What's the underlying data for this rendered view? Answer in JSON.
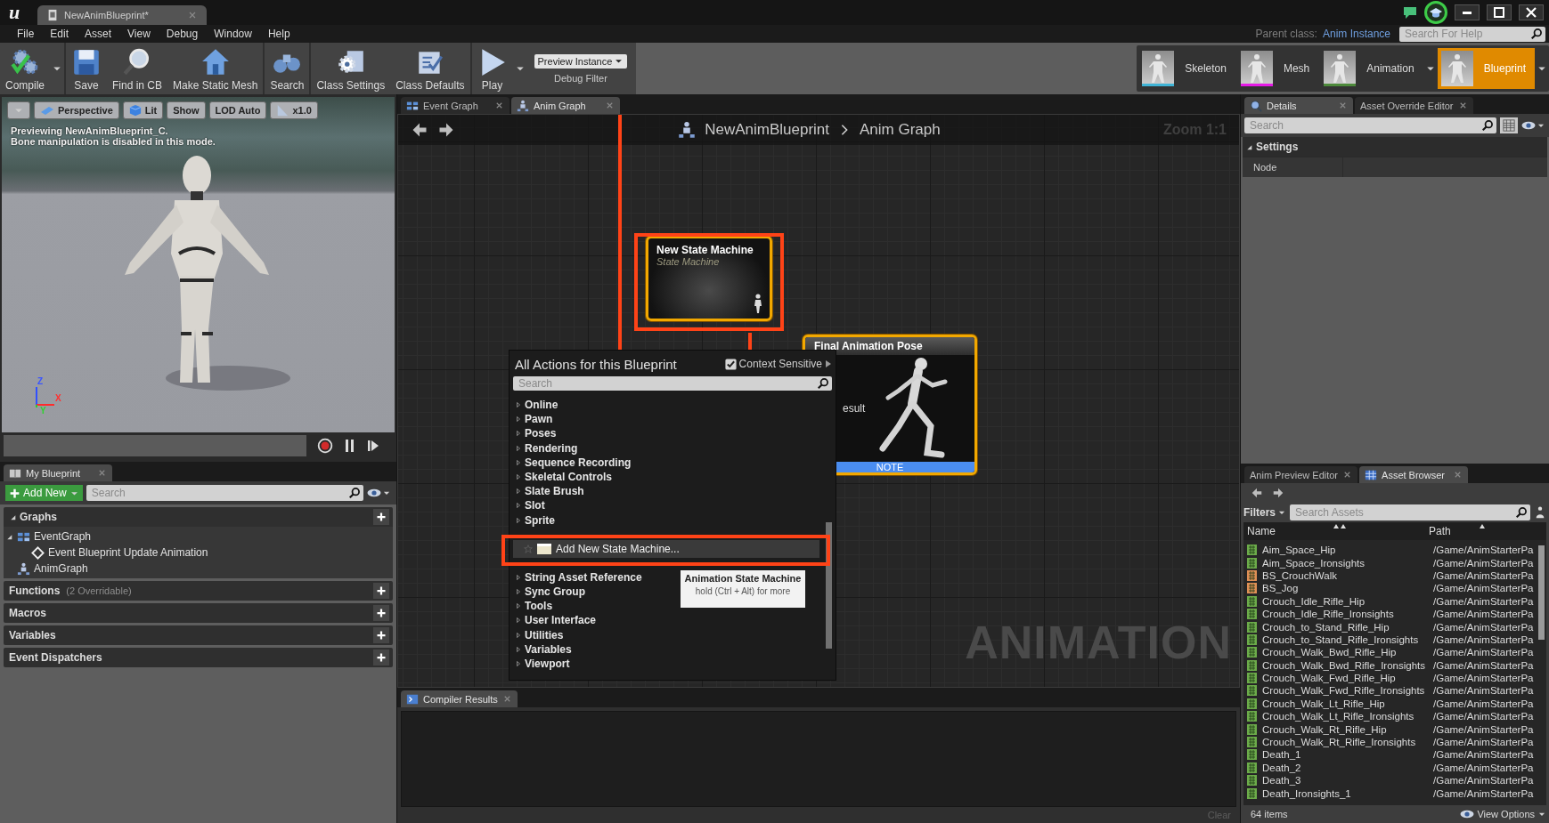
{
  "window": {
    "logo": "u",
    "document_tab": {
      "label": "NewAnimBlueprint*",
      "selected": true
    }
  },
  "menu": [
    "File",
    "Edit",
    "Asset",
    "View",
    "Debug",
    "Window",
    "Help"
  ],
  "parent_class": {
    "label": "Parent class:",
    "value": "Anim Instance"
  },
  "help_search": {
    "placeholder": "Search For Help"
  },
  "toolbar": [
    {
      "label": "Compile",
      "kind": "compile",
      "dropdown": true
    },
    {
      "label": "Save",
      "kind": "save",
      "dropdown": false
    },
    {
      "label": "Find in CB",
      "kind": "find",
      "dropdown": false
    },
    {
      "label": "Make Static Mesh",
      "kind": "mesh",
      "dropdown": false
    },
    {
      "label": "Search",
      "kind": "binoculars",
      "dropdown": false
    },
    {
      "label": "Class Settings",
      "kind": "settings",
      "dropdown": false
    },
    {
      "label": "Class Defaults",
      "kind": "defaults",
      "dropdown": false
    },
    {
      "label": "Play",
      "kind": "play",
      "dropdown": true
    }
  ],
  "debug_filter": {
    "value": "Preview Instance",
    "label": "Debug Filter"
  },
  "modes": [
    {
      "label": "Skeleton",
      "color": "#3fb4d6",
      "selected": false,
      "dropdown": false
    },
    {
      "label": "Mesh",
      "color": "#e619e6",
      "selected": false,
      "dropdown": false
    },
    {
      "label": "Animation",
      "color": "#4d8a3b",
      "selected": false,
      "dropdown": true
    },
    {
      "label": "Blueprint",
      "selected": true,
      "dropdown": true
    }
  ],
  "viewport": {
    "buttons": [
      {
        "label": "Perspective",
        "kind": "perspective"
      },
      {
        "label": "Lit",
        "kind": "lit"
      },
      {
        "label": "Show",
        "kind": "plain"
      },
      {
        "label": "LOD Auto",
        "kind": "plain"
      },
      {
        "label": "x1.0",
        "kind": "speed"
      }
    ],
    "messages": [
      "Previewing NewAnimBlueprint_C.",
      "Bone manipulation is disabled in this mode."
    ],
    "axes": {
      "z": "Z",
      "x": "X",
      "y": "Y"
    }
  },
  "my_blueprint": {
    "tab": {
      "label": "My Blueprint",
      "kind": "book",
      "selected": true
    },
    "add_new": "Add New",
    "search": {
      "placeholder": "Search"
    },
    "sections": [
      {
        "title": "Graphs",
        "expanded": true,
        "children": [
          {
            "label": "EventGraph",
            "kind": "event_graph",
            "expanded": true,
            "children": [
              {
                "label": "Event Blueprint Update Animation",
                "kind": "event"
              }
            ]
          },
          {
            "label": "AnimGraph",
            "kind": "anim_graph"
          }
        ]
      },
      {
        "title": "Functions",
        "note": "(2 Overridable)",
        "expanded": false
      },
      {
        "title": "Macros",
        "expanded": false
      },
      {
        "title": "Variables",
        "expanded": false
      },
      {
        "title": "Event Dispatchers",
        "expanded": false
      }
    ]
  },
  "graph_tabs": [
    {
      "label": "Event Graph",
      "kind": "graph",
      "selected": false
    },
    {
      "label": "Anim Graph",
      "kind": "anim",
      "selected": true
    }
  ],
  "graph": {
    "breadcrumb": [
      "NewAnimBlueprint",
      "Anim Graph"
    ],
    "zoom": "Zoom 1:1",
    "watermark": "ANIMATION",
    "nodes": [
      {
        "kind": "state_machine",
        "title": "New State Machine",
        "subtitle": "State Machine",
        "selected": true
      },
      {
        "kind": "result",
        "title": "Final Animation Pose",
        "pin": "esult",
        "footer": "NOTE",
        "selected": true
      }
    ]
  },
  "action_menu": {
    "title": "All Actions for this Blueprint",
    "context_sensitive": {
      "label": "Context Sensitive",
      "checked": true
    },
    "search": {
      "placeholder": "Search"
    },
    "items": [
      {
        "label": "Online",
        "kind": "category",
        "selected": false
      },
      {
        "label": "Pawn",
        "kind": "category",
        "selected": false
      },
      {
        "label": "Poses",
        "kind": "category",
        "selected": false
      },
      {
        "label": "Rendering",
        "kind": "category",
        "selected": false
      },
      {
        "label": "Sequence Recording",
        "kind": "category",
        "selected": false
      },
      {
        "label": "Skeletal Controls",
        "kind": "category",
        "selected": false
      },
      {
        "label": "Slate Brush",
        "kind": "category",
        "selected": false
      },
      {
        "label": "Slot",
        "kind": "category",
        "selected": false
      },
      {
        "label": "Sprite",
        "kind": "category",
        "selected": false
      },
      {
        "label": "Add New State Machine...",
        "kind": "action",
        "selected": true
      },
      {
        "label": "String Asset Reference",
        "kind": "category",
        "selected": false
      },
      {
        "label": "Sync Group",
        "kind": "category",
        "selected": false
      },
      {
        "label": "Tools",
        "kind": "category",
        "selected": false
      },
      {
        "label": "User Interface",
        "kind": "category",
        "selected": false
      },
      {
        "label": "Utilities",
        "kind": "category",
        "selected": false
      },
      {
        "label": "Variables",
        "kind": "category",
        "selected": false
      },
      {
        "label": "Viewport",
        "kind": "category",
        "selected": false
      }
    ],
    "tooltip": {
      "title": "Animation State Machine",
      "hint": "hold (Ctrl + Alt) for more"
    }
  },
  "compiler": {
    "tab": {
      "label": "Compiler Results",
      "kind": "terminal",
      "selected": true
    },
    "clear": "Clear"
  },
  "details": {
    "tabs": [
      {
        "label": "Details",
        "kind": "details",
        "selected": true
      },
      {
        "label": "Asset Override Editor",
        "kind": "plain",
        "selected": false
      }
    ],
    "search": {
      "placeholder": "Search"
    },
    "sections": [
      {
        "title": "Settings",
        "expanded": true,
        "rows": [
          "Node"
        ]
      }
    ]
  },
  "asset_browser": {
    "tabs": [
      {
        "label": "Anim Preview Editor",
        "kind": "plain",
        "selected": false
      },
      {
        "label": "Asset Browser",
        "kind": "grid",
        "selected": true
      }
    ],
    "filters": "Filters",
    "search": {
      "placeholder": "Search Assets"
    },
    "columns": [
      "Name",
      "Path"
    ],
    "rows": [
      {
        "name": "Aim_Space_Hip",
        "path": "/Game/AnimStarterPa",
        "color": "#6cab4a"
      },
      {
        "name": "Aim_Space_Ironsights",
        "path": "/Game/AnimStarterPa",
        "color": "#6cab4a"
      },
      {
        "name": "BS_CrouchWalk",
        "path": "/Game/AnimStarterPa",
        "color": "#de8f55"
      },
      {
        "name": "BS_Jog",
        "path": "/Game/AnimStarterPa",
        "color": "#de8f55"
      },
      {
        "name": "Crouch_Idle_Rifle_Hip",
        "path": "/Game/AnimStarterPa",
        "color": "#6cab4a"
      },
      {
        "name": "Crouch_Idle_Rifle_Ironsights",
        "path": "/Game/AnimStarterPa",
        "color": "#6cab4a"
      },
      {
        "name": "Crouch_to_Stand_Rifle_Hip",
        "path": "/Game/AnimStarterPa",
        "color": "#6cab4a"
      },
      {
        "name": "Crouch_to_Stand_Rifle_Ironsights",
        "path": "/Game/AnimStarterPa",
        "color": "#6cab4a"
      },
      {
        "name": "Crouch_Walk_Bwd_Rifle_Hip",
        "path": "/Game/AnimStarterPa",
        "color": "#6cab4a"
      },
      {
        "name": "Crouch_Walk_Bwd_Rifle_Ironsights",
        "path": "/Game/AnimStarterPa",
        "color": "#6cab4a"
      },
      {
        "name": "Crouch_Walk_Fwd_Rifle_Hip",
        "path": "/Game/AnimStarterPa",
        "color": "#6cab4a"
      },
      {
        "name": "Crouch_Walk_Fwd_Rifle_Ironsights",
        "path": "/Game/AnimStarterPa",
        "color": "#6cab4a"
      },
      {
        "name": "Crouch_Walk_Lt_Rifle_Hip",
        "path": "/Game/AnimStarterPa",
        "color": "#6cab4a"
      },
      {
        "name": "Crouch_Walk_Lt_Rifle_Ironsights",
        "path": "/Game/AnimStarterPa",
        "color": "#6cab4a"
      },
      {
        "name": "Crouch_Walk_Rt_Rifle_Hip",
        "path": "/Game/AnimStarterPa",
        "color": "#6cab4a"
      },
      {
        "name": "Crouch_Walk_Rt_Rifle_Ironsights",
        "path": "/Game/AnimStarterPa",
        "color": "#6cab4a"
      },
      {
        "name": "Death_1",
        "path": "/Game/AnimStarterPa",
        "color": "#6cab4a"
      },
      {
        "name": "Death_2",
        "path": "/Game/AnimStarterPa",
        "color": "#6cab4a"
      },
      {
        "name": "Death_3",
        "path": "/Game/AnimStarterPa",
        "color": "#6cab4a"
      },
      {
        "name": "Death_Ironsights_1",
        "path": "/Game/AnimStarterPa",
        "color": "#6cab4a"
      }
    ],
    "count": "64 items",
    "view_options": "View Options"
  }
}
